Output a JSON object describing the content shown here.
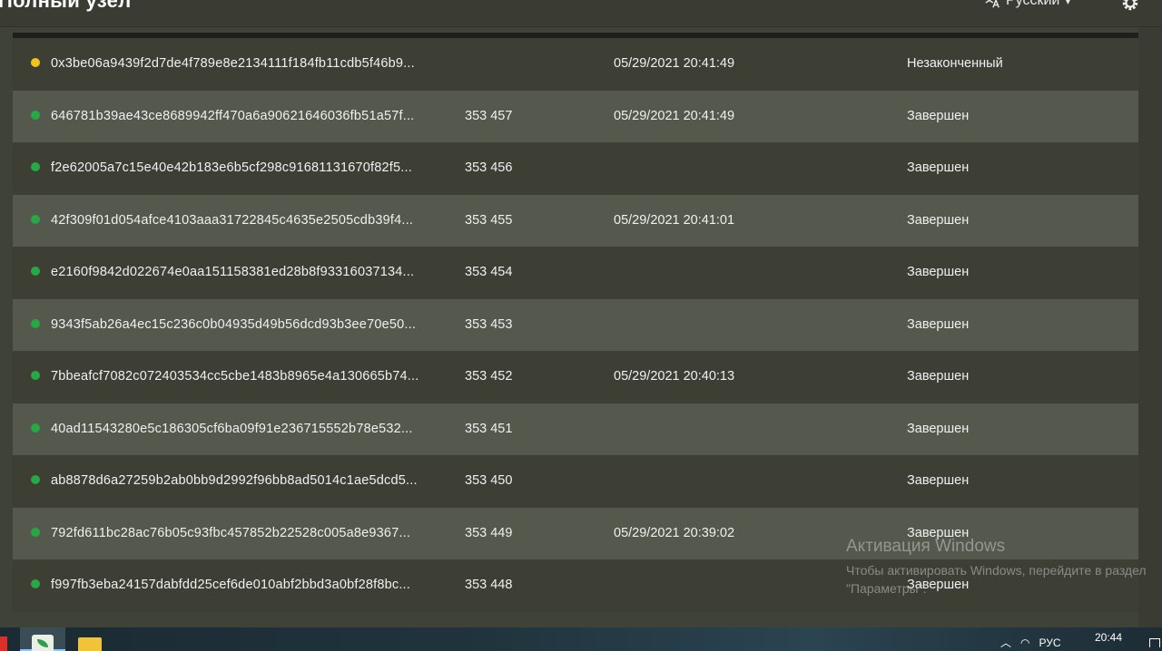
{
  "header": {
    "title": "Полный узел",
    "language": "Русский",
    "settings_icon": "gear-icon"
  },
  "colors": {
    "pending_dot": "#f2c419",
    "complete_dot": "#27a844"
  },
  "rows": [
    {
      "status_dot": "pending",
      "hash": "0x3be06a9439f2d7de4f789e8e2134111f184fb11cdb5f46b9...",
      "height": "",
      "time": "05/29/2021 20:41:49",
      "status": "Незаконченный"
    },
    {
      "status_dot": "complete",
      "hash": "646781b39ae43ce8689942ff470a6a90621646036fb51a57f...",
      "height": "353 457",
      "time": "05/29/2021 20:41:49",
      "status": "Завершен"
    },
    {
      "status_dot": "complete",
      "hash": "f2e62005a7c15e40e42b183e6b5cf298c91681131670f82f5...",
      "height": "353 456",
      "time": "",
      "status": "Завершен"
    },
    {
      "status_dot": "complete",
      "hash": "42f309f01d054afce4103aaa31722845c4635e2505cdb39f4...",
      "height": "353 455",
      "time": "05/29/2021 20:41:01",
      "status": "Завершен"
    },
    {
      "status_dot": "complete",
      "hash": "e2160f9842d022674e0aa151158381ed28b8f93316037134...",
      "height": "353 454",
      "time": "",
      "status": "Завершен"
    },
    {
      "status_dot": "complete",
      "hash": "9343f5ab26a4ec15c236c0b04935d49b56dcd93b3ee70e50...",
      "height": "353 453",
      "time": "",
      "status": "Завершен"
    },
    {
      "status_dot": "complete",
      "hash": "7bbeafcf7082c072403534cc5cbe1483b8965e4a130665b74...",
      "height": "353 452",
      "time": "05/29/2021 20:40:13",
      "status": "Завершен"
    },
    {
      "status_dot": "complete",
      "hash": "40ad11543280e5c186305cf6ba09f91e236715552b78e532...",
      "height": "353 451",
      "time": "",
      "status": "Завершен"
    },
    {
      "status_dot": "complete",
      "hash": "ab8878d6a27259b2ab0bb9d2992f96bb8ad5014c1ae5dcd5...",
      "height": "353 450",
      "time": "",
      "status": "Завершен"
    },
    {
      "status_dot": "complete",
      "hash": "792fd611bc28ac76b05c93fbc457852b22528c005a8e9367...",
      "height": "353 449",
      "time": "05/29/2021 20:39:02",
      "status": "Завершен"
    },
    {
      "status_dot": "complete",
      "hash": "f997fb3eba24157dabfdd25cef6de010abf2bbd3a0bf28f8bc...",
      "height": "353 448",
      "time": "",
      "status": "Завершен"
    }
  ],
  "watermark": {
    "title": "Активация Windows",
    "subtitle": "Чтобы активировать Windows, перейдите в раздел \"Параметры\"."
  },
  "taskbar": {
    "input_language": "РУС",
    "clock": "20:44"
  }
}
